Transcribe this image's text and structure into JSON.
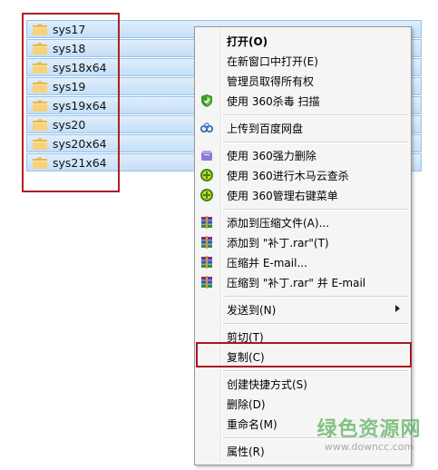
{
  "files": [
    {
      "name": "sys17"
    },
    {
      "name": "sys18"
    },
    {
      "name": "sys18x64"
    },
    {
      "name": "sys19"
    },
    {
      "name": "sys19x64"
    },
    {
      "name": "sys20"
    },
    {
      "name": "sys20x64"
    },
    {
      "name": "sys21x64"
    }
  ],
  "menu": {
    "open": "打开(O)",
    "open_new_window": "在新窗口中打开(E)",
    "take_ownership": "管理员取得所有权",
    "scan_360": "使用 360杀毒 扫描",
    "upload_baidu": "上传到百度网盘",
    "force_delete_360": "使用 360强力删除",
    "trojan_scan_360": "使用 360进行木马云查杀",
    "manage_menu_360": "使用 360管理右键菜单",
    "add_to_archive": "添加到压缩文件(A)...",
    "add_to_rar": "添加到 \"补丁.rar\"(T)",
    "compress_email": "压缩并 E-mail...",
    "compress_rar_email": "压缩到 \"补丁.rar\" 并 E-mail",
    "send_to": "发送到(N)",
    "cut": "剪切(T)",
    "copy": "复制(C)",
    "create_shortcut": "创建快捷方式(S)",
    "delete": "删除(D)",
    "rename": "重命名(M)",
    "properties": "属性(R)"
  },
  "watermark": {
    "title": "绿色资源网",
    "url": "www.downcc.com"
  },
  "colors": {
    "highlight_border": "#b01e24",
    "row_bg": "#cfe4f8",
    "menu_bg": "#f5f5f5"
  },
  "icons": {
    "folder": "folder-icon",
    "shield": "360-shield-icon",
    "baidu": "baidu-cloud-icon",
    "winrar": "winrar-books-icon"
  }
}
